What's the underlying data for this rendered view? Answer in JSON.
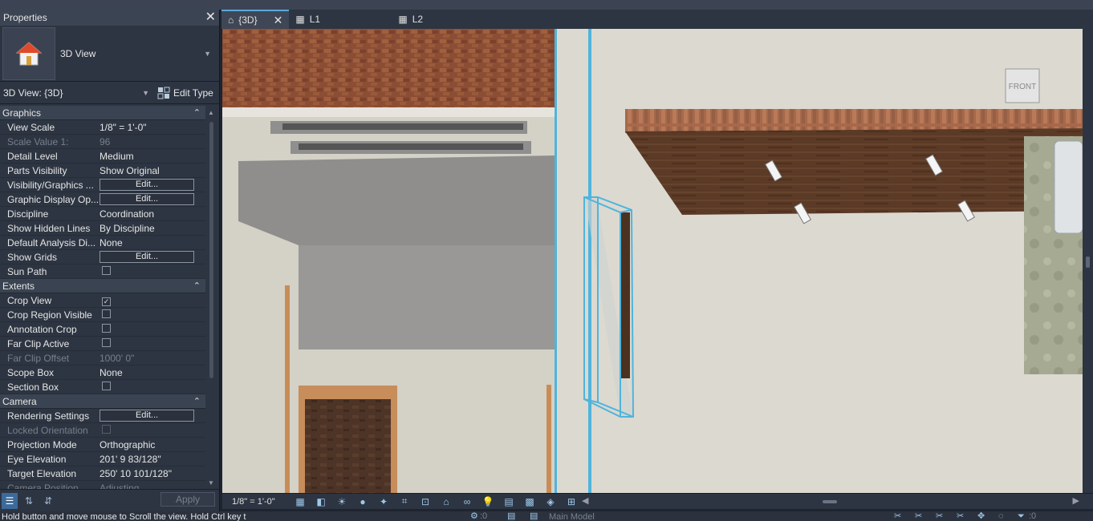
{
  "properties": {
    "title": "Properties",
    "type_name": "3D View",
    "instance_selector": "3D View: {3D}",
    "edit_type_label": "Edit Type",
    "apply_label": "Apply",
    "sections": [
      {
        "title": "Graphics",
        "rows": [
          {
            "name": "View Scale",
            "value": "1/8\" = 1'-0\"",
            "kind": "text"
          },
          {
            "name": "Scale Value    1:",
            "value": "96",
            "kind": "text",
            "disabled": true
          },
          {
            "name": "Detail Level",
            "value": "Medium",
            "kind": "text"
          },
          {
            "name": "Parts Visibility",
            "value": "Show Original",
            "kind": "text"
          },
          {
            "name": "Visibility/Graphics ...",
            "value": "Edit...",
            "kind": "button"
          },
          {
            "name": "Graphic Display Op...",
            "value": "Edit...",
            "kind": "button"
          },
          {
            "name": "Discipline",
            "value": "Coordination",
            "kind": "text"
          },
          {
            "name": "Show Hidden Lines",
            "value": "By Discipline",
            "kind": "text"
          },
          {
            "name": "Default Analysis Di...",
            "value": "None",
            "kind": "text"
          },
          {
            "name": "Show Grids",
            "value": "Edit...",
            "kind": "button"
          },
          {
            "name": "Sun Path",
            "value": "",
            "kind": "checkbox",
            "checked": false
          }
        ]
      },
      {
        "title": "Extents",
        "rows": [
          {
            "name": "Crop View",
            "value": "",
            "kind": "checkbox",
            "checked": true
          },
          {
            "name": "Crop Region Visible",
            "value": "",
            "kind": "checkbox",
            "checked": false
          },
          {
            "name": "Annotation Crop",
            "value": "",
            "kind": "checkbox",
            "checked": false
          },
          {
            "name": "Far Clip Active",
            "value": "",
            "kind": "checkbox",
            "checked": false
          },
          {
            "name": "Far Clip Offset",
            "value": "1000'  0\"",
            "kind": "text",
            "disabled": true
          },
          {
            "name": "Scope Box",
            "value": "None",
            "kind": "text"
          },
          {
            "name": "Section Box",
            "value": "",
            "kind": "checkbox",
            "checked": false
          }
        ]
      },
      {
        "title": "Camera",
        "rows": [
          {
            "name": "Rendering Settings",
            "value": "Edit...",
            "kind": "button"
          },
          {
            "name": "Locked Orientation",
            "value": "",
            "kind": "checkbox",
            "checked": false,
            "disabled": true
          },
          {
            "name": "Projection Mode",
            "value": "Orthographic",
            "kind": "text"
          },
          {
            "name": "Eye Elevation",
            "value": "201'  9 83/128\"",
            "kind": "text"
          },
          {
            "name": "Target Elevation",
            "value": "250'  10 101/128\"",
            "kind": "text"
          },
          {
            "name": "Camera Position",
            "value": "Adjusting",
            "kind": "text",
            "disabled": true
          }
        ]
      }
    ]
  },
  "tabs": [
    {
      "label": "{3D}",
      "icon": "home-icon",
      "active": true
    },
    {
      "label": "L1",
      "icon": "plan-view-icon",
      "active": false
    },
    {
      "label": "L2",
      "icon": "plan-view-icon",
      "active": false
    }
  ],
  "viewport": {
    "viewcube_label": "FRONT"
  },
  "view_control_bar": {
    "scale": "1/8\" = 1'-0\""
  },
  "status_bar": {
    "message": "Hold button and move mouse to Scroll the view. Hold Ctrl key t",
    "workset_count": ":0",
    "model_label": "Main Model",
    "filter_count": ":0"
  },
  "colors": {
    "panel_bg": "#2d3542",
    "accent": "#5aa7dd",
    "selection": "#4fb4dc"
  }
}
